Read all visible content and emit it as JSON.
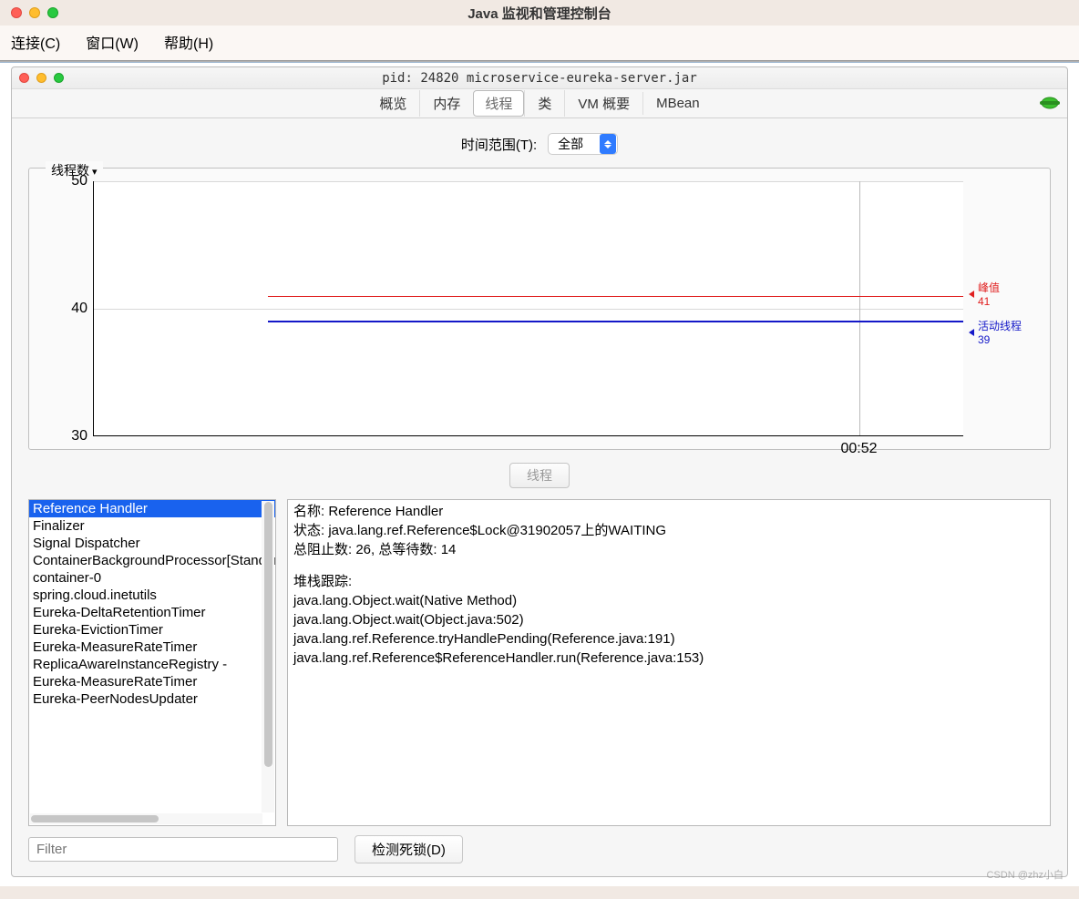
{
  "outer": {
    "title": "Java 监视和管理控制台",
    "menu": [
      "连接(C)",
      "窗口(W)",
      "帮助(H)"
    ]
  },
  "inner": {
    "title": "pid: 24820 microservice-eureka-server.jar",
    "tabs": [
      {
        "label": "概览"
      },
      {
        "label": "内存"
      },
      {
        "label": "线程",
        "active": true
      },
      {
        "label": "类"
      },
      {
        "label": "VM 概要"
      },
      {
        "label": "MBean"
      }
    ]
  },
  "range": {
    "label": "时间范围(T):",
    "selected": "全部"
  },
  "chart_data": {
    "type": "line",
    "title": "线程数",
    "ylim": [
      30,
      50
    ],
    "y_ticks": [
      30,
      40,
      50
    ],
    "x_ticks": [
      "00:52"
    ],
    "series": [
      {
        "name": "峰值",
        "value": 41,
        "color": "#e02020"
      },
      {
        "name": "活动线程",
        "value": 39,
        "color": "#1418c8"
      }
    ]
  },
  "thread_button": "线程",
  "threads": [
    "Reference Handler",
    "Finalizer",
    "Signal Dispatcher",
    "ContainerBackgroundProcessor[StandardEngine",
    "container-0",
    "spring.cloud.inetutils",
    "Eureka-DeltaRetentionTimer",
    "Eureka-EvictionTimer",
    "Eureka-MeasureRateTimer",
    "ReplicaAwareInstanceRegistry -",
    "Eureka-MeasureRateTimer",
    "Eureka-PeerNodesUpdater"
  ],
  "selected_thread_index": 0,
  "detail": {
    "name_label": "名称:",
    "name": "Reference Handler",
    "state_label": "状态:",
    "state": "java.lang.ref.Reference$Lock@31902057上的WAITING",
    "counts": "总阻止数: 26, 总等待数: 14",
    "trace_label": "堆栈跟踪:",
    "trace": [
      "java.lang.Object.wait(Native Method)",
      "java.lang.Object.wait(Object.java:502)",
      "java.lang.ref.Reference.tryHandlePending(Reference.java:191)",
      "java.lang.ref.Reference$ReferenceHandler.run(Reference.java:153)"
    ]
  },
  "filter_placeholder": "Filter",
  "deadlock_button": "检测死锁(D)",
  "watermark": "CSDN @zhz小白"
}
